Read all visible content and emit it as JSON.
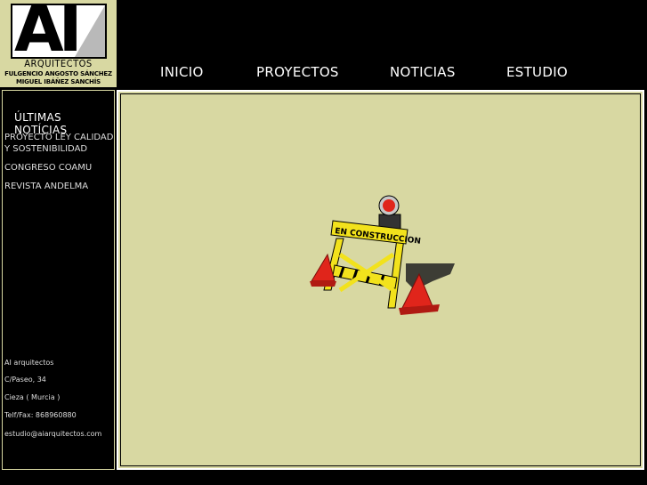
{
  "logo": {
    "letters": "AI",
    "word": "ARQUITECTOS",
    "name_1": "FULGENCIO ANGOSTO SÁNCHEZ",
    "name_2": "MIGUEL IBÁÑEZ SANCHÍS"
  },
  "nav": {
    "items": [
      {
        "label": "INICIO"
      },
      {
        "label": "PROYECTOS"
      },
      {
        "label": "NOTICIAS"
      },
      {
        "label": "ESTUDIO"
      }
    ]
  },
  "sidebar": {
    "heading": "ÚLTIMAS NOTÍCIAS",
    "news": [
      {
        "label": "PROYECTO LEY CALIDAD Y SOSTENIBILIDAD"
      },
      {
        "label": "CONGRESO COAMU"
      },
      {
        "label": "REVISTA ANDELMA"
      }
    ],
    "contact": {
      "company": "AI arquitectos",
      "street": "C/Paseo, 34",
      "city": "Cieza ( Murcia )",
      "phone": "Telf/Fax: 868960880",
      "email": "estudio@aiarquitectos.com"
    }
  },
  "content": {
    "sign_text": "EN CONSTRUCCION",
    "background_color": "#d8d8a2",
    "barrier_color": "#f2e21c",
    "cone_color": "#e0251b"
  }
}
